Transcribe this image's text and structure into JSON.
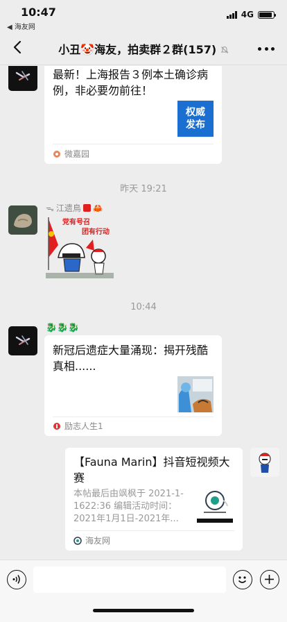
{
  "status_bar": {
    "time": "10:47",
    "back_app": "◀ 海友网",
    "network": "4G"
  },
  "nav": {
    "title": "小丑🤡海友，拍卖群２群(157)"
  },
  "messages": [
    {
      "title": "最新！上海报告３例本土确诊病例，非必要勿前往！",
      "thumb_text": "权威发布",
      "source": "微嘉园"
    },
    {
      "timestamp": "昨天 19:21"
    },
    {
      "nickname": "江遗鳥",
      "badge_emoji": "🦀",
      "sticker_texts": [
        "党有号召",
        "团有行动"
      ]
    },
    {
      "timestamp": "10:44"
    },
    {
      "nickname_emoji": "🐉🐉🐉",
      "title": "新冠后遗症大量涌现：揭开残酷真相......",
      "source": "励志人生1"
    },
    {
      "title": "【Fauna Marin】抖音短视频大赛",
      "desc": "本帖最后由飒枫于 2021-1-1622:36 编辑活动时间：2021年1月1日-2021年...",
      "source": "海友网"
    }
  ],
  "colors": {
    "background": "#ededed",
    "card": "#ffffff",
    "muted": "#999999",
    "flag_red": "#e02020"
  }
}
